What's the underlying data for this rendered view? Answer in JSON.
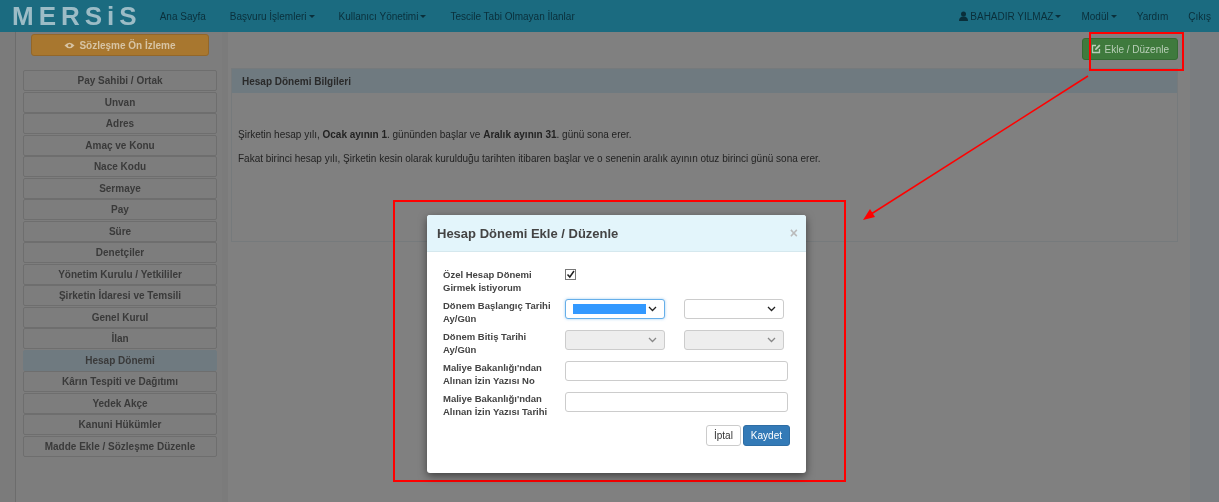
{
  "navbar": {
    "logo": "MERSiS",
    "items": [
      {
        "label": "Ana Sayfa",
        "has_menu": false
      },
      {
        "label": "Başvuru İşlemleri",
        "has_menu": true
      },
      {
        "label": "Kullanıcı Yönetimi",
        "has_menu": true
      },
      {
        "label": "Tescile Tabi Olmayan İlanlar",
        "has_menu": false
      }
    ],
    "right_items": [
      {
        "label": "BAHADIR YILMAZ",
        "has_menu": true,
        "kind": "user"
      },
      {
        "label": "Modül",
        "has_menu": true,
        "kind": "link"
      },
      {
        "label": "Yardım",
        "has_menu": false,
        "kind": "link"
      },
      {
        "label": "Çıkış",
        "has_menu": false,
        "kind": "link"
      }
    ]
  },
  "preview_button": "Sözleşme Ön İzleme",
  "sidebar": {
    "items": [
      {
        "label": "Pay Sahibi / Ortak",
        "selected": false
      },
      {
        "label": "Unvan",
        "selected": false
      },
      {
        "label": "Adres",
        "selected": false
      },
      {
        "label": "Amaç ve Konu",
        "selected": false
      },
      {
        "label": "Nace Kodu",
        "selected": false
      },
      {
        "label": "Sermaye",
        "selected": false
      },
      {
        "label": "Pay",
        "selected": false
      },
      {
        "label": "Süre",
        "selected": false
      },
      {
        "label": "Denetçiler",
        "selected": false
      },
      {
        "label": "Yönetim Kurulu / Yetkililer",
        "selected": false
      },
      {
        "label": "Şirketin İdaresi ve Temsili",
        "selected": false
      },
      {
        "label": "Genel Kurul",
        "selected": false
      },
      {
        "label": "İlan",
        "selected": false
      },
      {
        "label": "Hesap Dönemi",
        "selected": true
      },
      {
        "label": "Kârın Tespiti ve Dağıtımı",
        "selected": false
      },
      {
        "label": "Yedek Akçe",
        "selected": false
      },
      {
        "label": "Kanuni Hükümler",
        "selected": false
      },
      {
        "label": "Madde Ekle / Sözleşme Düzenle",
        "selected": false
      }
    ]
  },
  "edit_button": "Ekle / Düzenle",
  "panel": {
    "title": "Hesap Dönemi Bilgileri",
    "paragraphs": [
      "Şirketin hesap yılı, **Ocak ayının 1**. gününden başlar ve **Aralık ayının 31**. günü sona erer.",
      "Fakat birinci hesap yılı, Şirketin kesin olarak kurulduğu tarihten itibaren başlar ve o senenin aralık ayının otuz birinci günü sona erer."
    ]
  },
  "modal": {
    "title": "Hesap Dönemi Ekle / Düzenle",
    "close": "×",
    "fields": [
      {
        "kind": "checkbox",
        "label": "Özel Hesap Dönemi Girmek İstiyorum",
        "checked": true
      },
      {
        "kind": "select-pair",
        "label": "Dönem Başlangıç Tarihi Ay/Gün",
        "selects": [
          {
            "disabled": false,
            "focused": true
          },
          {
            "disabled": false,
            "focused": false
          }
        ]
      },
      {
        "kind": "select-pair",
        "label": "Dönem Bitiş Tarihi Ay/Gün",
        "selects": [
          {
            "disabled": true,
            "focused": false
          },
          {
            "disabled": true,
            "focused": false
          }
        ]
      },
      {
        "kind": "text",
        "label": "Maliye Bakanlığı'ndan Alınan İzin Yazısı No"
      },
      {
        "kind": "text",
        "label": "Maliye Bakanlığı'ndan Alınan İzin Yazısı Tarihi"
      }
    ],
    "buttons": [
      {
        "label": "İptal",
        "kind": "default"
      },
      {
        "label": "Kaydet",
        "kind": "primary"
      }
    ]
  }
}
